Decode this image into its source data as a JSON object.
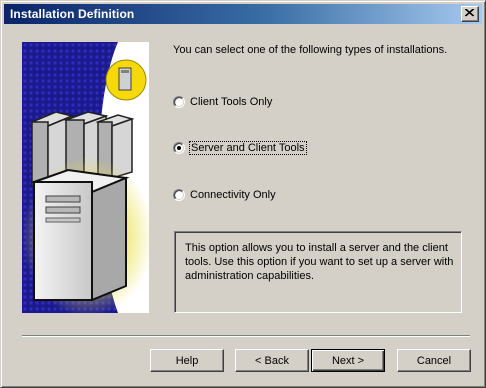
{
  "window": {
    "title": "Installation Definition"
  },
  "prompt": "You can select one of the following types of installations.",
  "options": [
    {
      "label": "Client Tools Only",
      "selected": false
    },
    {
      "label": "Server and Client Tools",
      "selected": true
    },
    {
      "label": "Connectivity Only",
      "selected": false
    }
  ],
  "description": "This option allows you to install a server and the client tools. Use this option if you want to set up a server with administration capabilities.",
  "buttons": {
    "help": "Help",
    "back": "< Back",
    "next": "Next >",
    "cancel": "Cancel"
  },
  "colors": {
    "title_gradient_start": "#0a246a",
    "title_gradient_end": "#a6caf0",
    "panel_background": "#1c1a8a",
    "panel_accent": "#f5d90a"
  }
}
